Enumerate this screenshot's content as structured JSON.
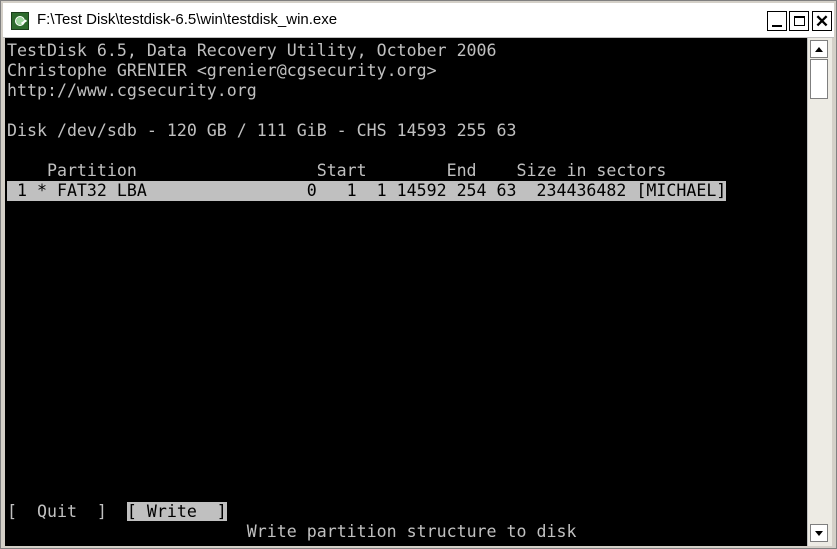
{
  "window": {
    "title": "F:\\Test Disk\\testdisk-6.5\\win\\testdisk_win.exe",
    "icon": "testdisk-app-icon",
    "controls": {
      "minimize_icon": "minimize-icon",
      "maximize_icon": "maximize-icon",
      "close_glyph": "✕"
    }
  },
  "console": {
    "header": [
      "TestDisk 6.5, Data Recovery Utility, October 2006",
      "Christophe GRENIER <grenier@cgsecurity.org>",
      "http://www.cgsecurity.org"
    ],
    "disk_info": "Disk /dev/sdb - 120 GB / 111 GiB - CHS 14593 255 63",
    "table_header": "    Partition                  Start        End    Size in sectors",
    "partitions": [
      " 1 * FAT32 LBA                0   1  1 14592 254 63  234436482 [MICHAEL]"
    ],
    "menu": {
      "quit_label": "[  Quit  ]",
      "write_label": "[ Write  ]"
    },
    "status_text": "Write partition structure to disk"
  },
  "colors": {
    "console_background": "#000000",
    "console_text": "#C0C0C0",
    "highlight_background": "#C0C0C0",
    "highlight_text": "#000000"
  },
  "scrollbar": {
    "up_icon": "arrow-up-icon",
    "down_icon": "arrow-down-icon"
  }
}
